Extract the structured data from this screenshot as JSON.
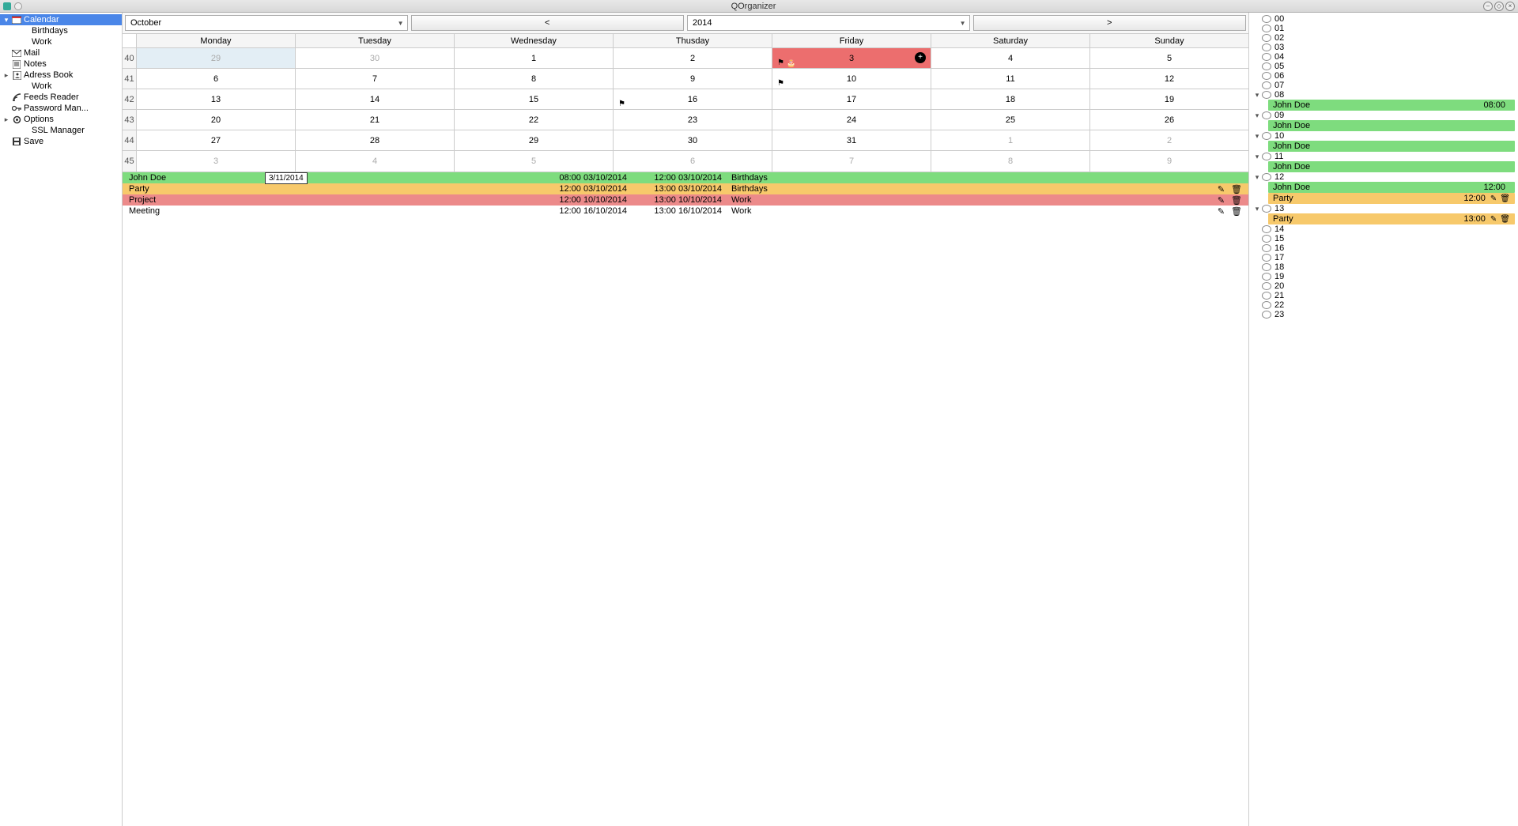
{
  "window": {
    "title": "QOrganizer"
  },
  "sidebar": {
    "items": [
      {
        "label": "Calendar",
        "icon": "calendar",
        "selected": true,
        "expandable": true,
        "expanded": true,
        "children": [
          {
            "label": "Birthdays"
          },
          {
            "label": "Work"
          }
        ]
      },
      {
        "label": "Mail",
        "icon": "mail"
      },
      {
        "label": "Notes",
        "icon": "notes"
      },
      {
        "label": "Adress Book",
        "icon": "addressbook",
        "expandable": true,
        "expanded": false,
        "children": [
          {
            "label": "Work"
          }
        ]
      },
      {
        "label": "Feeds Reader",
        "icon": "feeds"
      },
      {
        "label": "Password Man...",
        "icon": "password"
      },
      {
        "label": "Options",
        "icon": "options",
        "expandable": true,
        "expanded": false,
        "children": [
          {
            "label": "SSL Manager"
          }
        ]
      },
      {
        "label": "Save",
        "icon": "save"
      }
    ]
  },
  "toolbar": {
    "month": "October",
    "prev": "<",
    "year": "2014",
    "next": ">"
  },
  "calendar": {
    "days": [
      "Monday",
      "Tuesday",
      "Wednesday",
      "Thusday",
      "Friday",
      "Saturday",
      "Sunday"
    ],
    "rows": [
      {
        "wk": "40",
        "cells": [
          {
            "n": "29",
            "other": true,
            "selected": true
          },
          {
            "n": "30",
            "other": true
          },
          {
            "n": "1"
          },
          {
            "n": "2"
          },
          {
            "n": "3",
            "today": true,
            "flag": true,
            "cake": true,
            "plus": true
          },
          {
            "n": "4"
          },
          {
            "n": "5"
          }
        ]
      },
      {
        "wk": "41",
        "cells": [
          {
            "n": "6"
          },
          {
            "n": "7"
          },
          {
            "n": "8"
          },
          {
            "n": "9"
          },
          {
            "n": "10",
            "flag": true
          },
          {
            "n": "11"
          },
          {
            "n": "12"
          }
        ]
      },
      {
        "wk": "42",
        "cells": [
          {
            "n": "13"
          },
          {
            "n": "14"
          },
          {
            "n": "15"
          },
          {
            "n": "16",
            "flag": true
          },
          {
            "n": "17"
          },
          {
            "n": "18"
          },
          {
            "n": "19"
          }
        ]
      },
      {
        "wk": "43",
        "cells": [
          {
            "n": "20"
          },
          {
            "n": "21"
          },
          {
            "n": "22"
          },
          {
            "n": "23"
          },
          {
            "n": "24"
          },
          {
            "n": "25"
          },
          {
            "n": "26"
          }
        ]
      },
      {
        "wk": "44",
        "cells": [
          {
            "n": "27"
          },
          {
            "n": "28"
          },
          {
            "n": "29"
          },
          {
            "n": "30"
          },
          {
            "n": "31"
          },
          {
            "n": "1",
            "other": true
          },
          {
            "n": "2",
            "other": true
          }
        ]
      },
      {
        "wk": "45",
        "cells": [
          {
            "n": "3",
            "other": true
          },
          {
            "n": "4",
            "other": true
          },
          {
            "n": "5",
            "other": true
          },
          {
            "n": "6",
            "other": true
          },
          {
            "n": "7",
            "other": true
          },
          {
            "n": "8",
            "other": true
          },
          {
            "n": "9",
            "other": true
          }
        ]
      }
    ]
  },
  "datebox": "3/11/2014",
  "events": [
    {
      "title": "John Doe",
      "start": "08:00 03/10/2014",
      "end": "12:00 03/10/2014",
      "cat": "Birthdays",
      "color": "green",
      "actions": false
    },
    {
      "title": "Party",
      "start": "12:00 03/10/2014",
      "end": "13:00 03/10/2014",
      "cat": "Birthdays",
      "color": "orange",
      "actions": true
    },
    {
      "title": "Project",
      "start": "12:00 10/10/2014",
      "end": "13:00 10/10/2014",
      "cat": "Work",
      "color": "red",
      "actions": true
    },
    {
      "title": "Meeting",
      "start": "12:00 16/10/2014",
      "end": "13:00 16/10/2014",
      "cat": "Work",
      "color": "plain",
      "actions": true
    }
  ],
  "timeline": {
    "hours": [
      {
        "h": "00"
      },
      {
        "h": "01"
      },
      {
        "h": "02"
      },
      {
        "h": "03"
      },
      {
        "h": "04"
      },
      {
        "h": "05"
      },
      {
        "h": "06"
      },
      {
        "h": "07"
      },
      {
        "h": "08",
        "exp": true,
        "events": [
          {
            "name": "John Doe",
            "time": "08:00",
            "color": "green"
          }
        ]
      },
      {
        "h": "09",
        "exp": true,
        "events": [
          {
            "name": "John Doe",
            "time": "",
            "color": "green"
          }
        ]
      },
      {
        "h": "10",
        "exp": true,
        "events": [
          {
            "name": "John Doe",
            "time": "",
            "color": "green"
          }
        ]
      },
      {
        "h": "11",
        "exp": true,
        "events": [
          {
            "name": "John Doe",
            "time": "",
            "color": "green"
          }
        ]
      },
      {
        "h": "12",
        "exp": true,
        "events": [
          {
            "name": "John Doe",
            "time": "12:00",
            "color": "green"
          },
          {
            "name": "Party",
            "time": "12:00",
            "color": "orange",
            "actions": true
          }
        ]
      },
      {
        "h": "13",
        "exp": true,
        "events": [
          {
            "name": "Party",
            "time": "13:00",
            "color": "orange",
            "actions": true
          }
        ]
      },
      {
        "h": "14"
      },
      {
        "h": "15"
      },
      {
        "h": "16"
      },
      {
        "h": "17"
      },
      {
        "h": "18"
      },
      {
        "h": "19"
      },
      {
        "h": "20"
      },
      {
        "h": "21"
      },
      {
        "h": "22"
      },
      {
        "h": "23"
      }
    ]
  }
}
